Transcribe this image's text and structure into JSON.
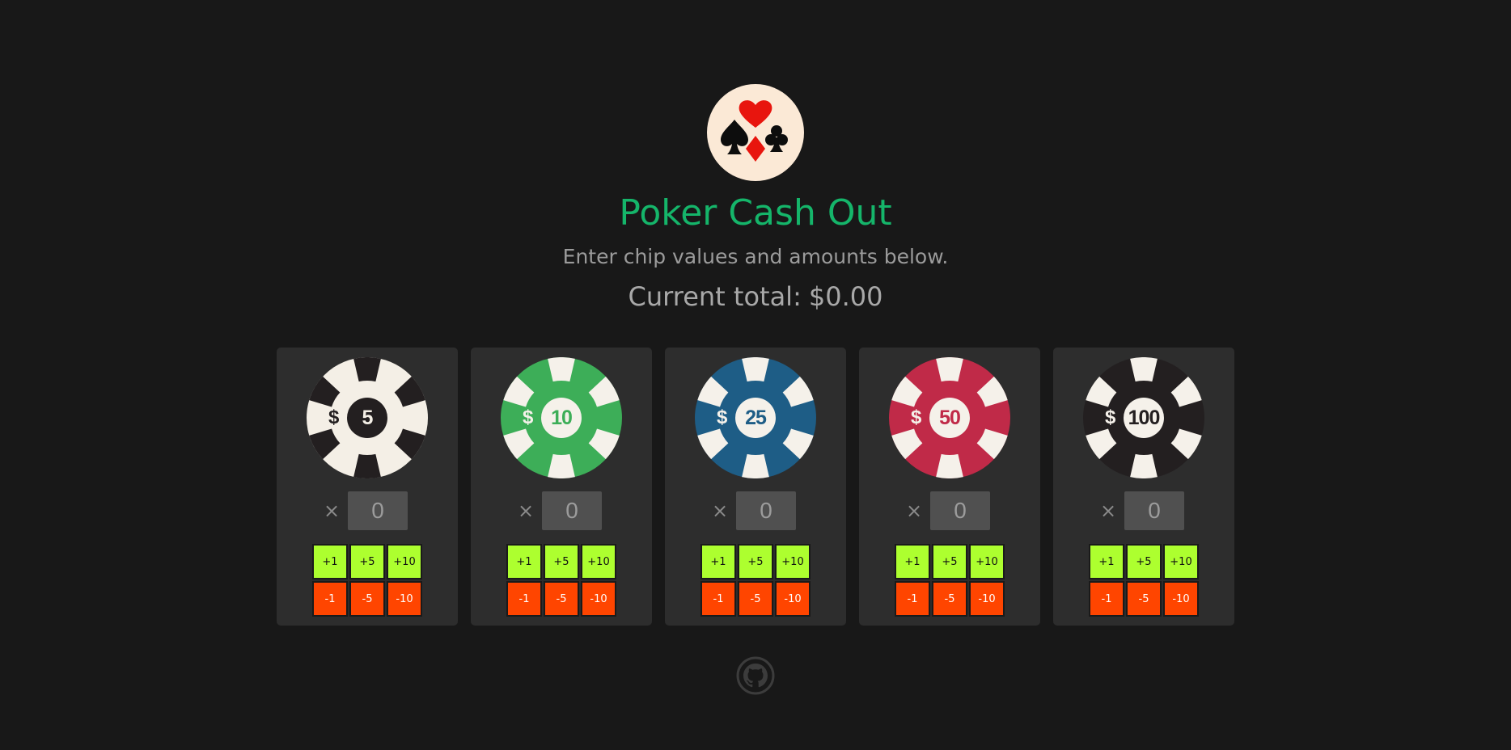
{
  "header": {
    "title": "Poker Cash Out",
    "subtitle": "Enter chip values and amounts below.",
    "total_label": "Current total:",
    "total_value": "$0.00"
  },
  "logo": {
    "icon": "card-suits-icon",
    "background": "#fbe9d6",
    "suit_black": "#0d0d0d",
    "suit_red": "#e8150e"
  },
  "colors": {
    "page_bg": "#181818",
    "card_bg": "#2d2d2d",
    "title": "#15b56a",
    "subtitle": "#9b9b9b",
    "total": "#a8a8a8",
    "plus_button": "#adff2f",
    "minus_button": "#ff4500",
    "input_bg": "#505050"
  },
  "multiply_symbol": "×",
  "chips": [
    {
      "currency": "$",
      "value": "5",
      "quantity": "0",
      "ring_color": "#f4efe6",
      "stripe_color": "#231f20",
      "center_color": "#231f20",
      "value_color": "#f4efe6",
      "dollar_color": "#231f20"
    },
    {
      "currency": "$",
      "value": "10",
      "quantity": "0",
      "ring_color": "#3dae58",
      "stripe_color": "#f5f1ea",
      "center_color": "#f5f1ea",
      "value_color": "#3dae58",
      "dollar_color": "#f5f1ea"
    },
    {
      "currency": "$",
      "value": "25",
      "quantity": "0",
      "ring_color": "#1e5d86",
      "stripe_color": "#f5f1ea",
      "center_color": "#f5f1ea",
      "value_color": "#1e5d86",
      "dollar_color": "#f5f1ea"
    },
    {
      "currency": "$",
      "value": "50",
      "quantity": "0",
      "ring_color": "#c02a48",
      "stripe_color": "#f5f1ea",
      "center_color": "#f5f1ea",
      "value_color": "#c02a48",
      "dollar_color": "#f5f1ea"
    },
    {
      "currency": "$",
      "value": "100",
      "quantity": "0",
      "ring_color": "#231f20",
      "stripe_color": "#f5f1ea",
      "center_color": "#f5f1ea",
      "value_color": "#231f20",
      "dollar_color": "#f5f1ea"
    }
  ],
  "increment_buttons": [
    "+1",
    "+5",
    "+10"
  ],
  "decrement_buttons": [
    "-1",
    "-5",
    "-10"
  ],
  "footer": {
    "icon": "github-icon",
    "color": "#3c3c3c"
  }
}
